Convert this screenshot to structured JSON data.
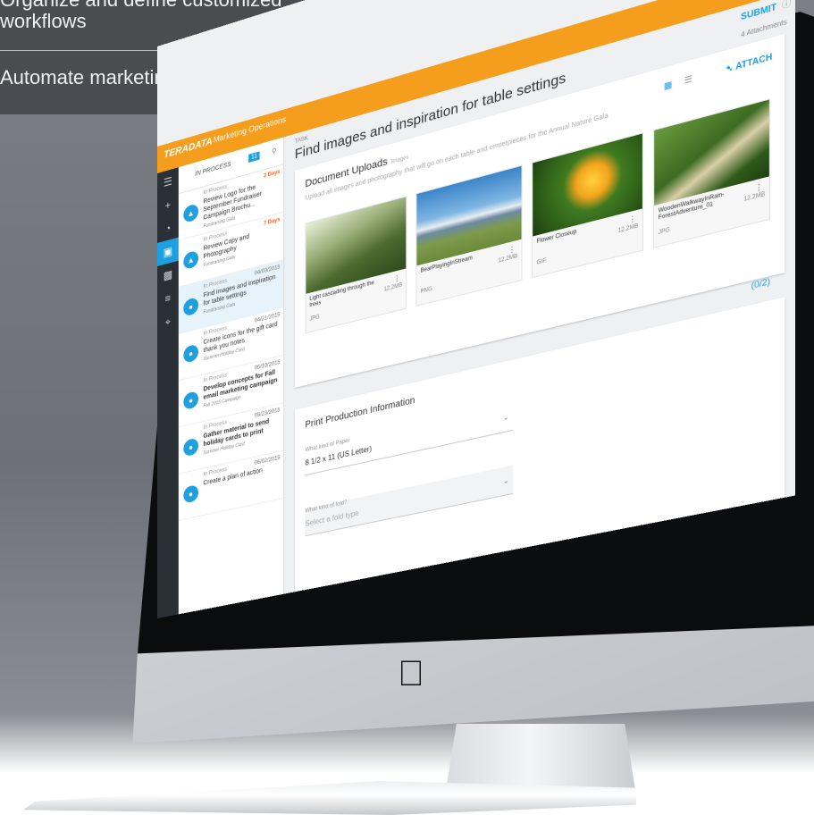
{
  "promo": {
    "line1": "Organize and define customized",
    "line2": "workflows",
    "line3": "Automate marketing production"
  },
  "app": {
    "brand": "TERADATA",
    "module": "Marketing Operations",
    "accent": "#f59d1d",
    "primary": "#1e9fe0",
    "topbar_icons": [
      "search-icon",
      "apps-grid-icon",
      "user-icon"
    ]
  },
  "rail": {
    "items": [
      "menu-icon",
      "add-icon",
      "dashboard-icon",
      "calendar-icon",
      "chat-icon",
      "sliders-icon",
      "workflow-icon"
    ]
  },
  "list": {
    "filter_label": "IN PROCESS",
    "count": "11",
    "tasks": [
      {
        "status": "In Process",
        "due": "3 Days",
        "title": "Review Logo for the September Fundraiser Campaign Brochu...",
        "project": "Fundraising Gala",
        "avatar": "▲"
      },
      {
        "status": "In Process",
        "due": "7 Days",
        "title": "Review Copy and Photography",
        "project": "Fundraising Gala",
        "avatar": "▲"
      },
      {
        "status": "In Process",
        "due": "04/03/2015",
        "title": "Find images and inspiration for table settings",
        "project": "Fundraising Gala",
        "avatar": "●"
      },
      {
        "status": "In Process",
        "due": "04/21/2015",
        "title": "Create icons for the gift card thank you notes",
        "project": "Summer Holiday Card",
        "avatar": "●"
      },
      {
        "status": "In Process",
        "due": "05/10/2015",
        "title": "Develop concepts for Fall email marketing campaign",
        "project": "Fall 2015 Campaign",
        "avatar": "●"
      },
      {
        "status": "In Process",
        "due": "05/23/2015",
        "title": "Gather material to send holiday cards to print",
        "project": "Summer Holiday Card",
        "avatar": "●"
      },
      {
        "status": "In Process",
        "due": "06/02/2015",
        "title": "Create a plan of action",
        "project": "",
        "avatar": "●"
      }
    ]
  },
  "main": {
    "task_label": "TASK",
    "title": "Find images and inspiration for table settings",
    "submit_label": "SUBMIT",
    "attachments_count": "4 Attachments",
    "uploads": {
      "title": "Document Uploads",
      "tag": "Images",
      "subtitle": "Upload all images and photography that will go on each table and centerpieces for the Annual Nature Gala",
      "attach_label": "ATTACH",
      "files": [
        {
          "name": "Light cascading through the trees",
          "type": "JPG",
          "size": "12.2MB"
        },
        {
          "name": "BearPlayingInStream",
          "type": "PNG",
          "size": "12.2MB"
        },
        {
          "name": "Flower Closeup",
          "type": "GIF",
          "size": "12.2MB"
        },
        {
          "name": "WoodenWalkwayInRain-ForestAdventure_01",
          "type": "JPG",
          "size": "12.2MB"
        }
      ],
      "pager": "(0/2)"
    },
    "print": {
      "title": "Print Production Information",
      "paper_label": "What kind of Paper",
      "paper_value": "8 1/2 x 11 (US Letter)",
      "fold_label": "What kind of fold?",
      "fold_placeholder": "Select a fold type"
    }
  }
}
